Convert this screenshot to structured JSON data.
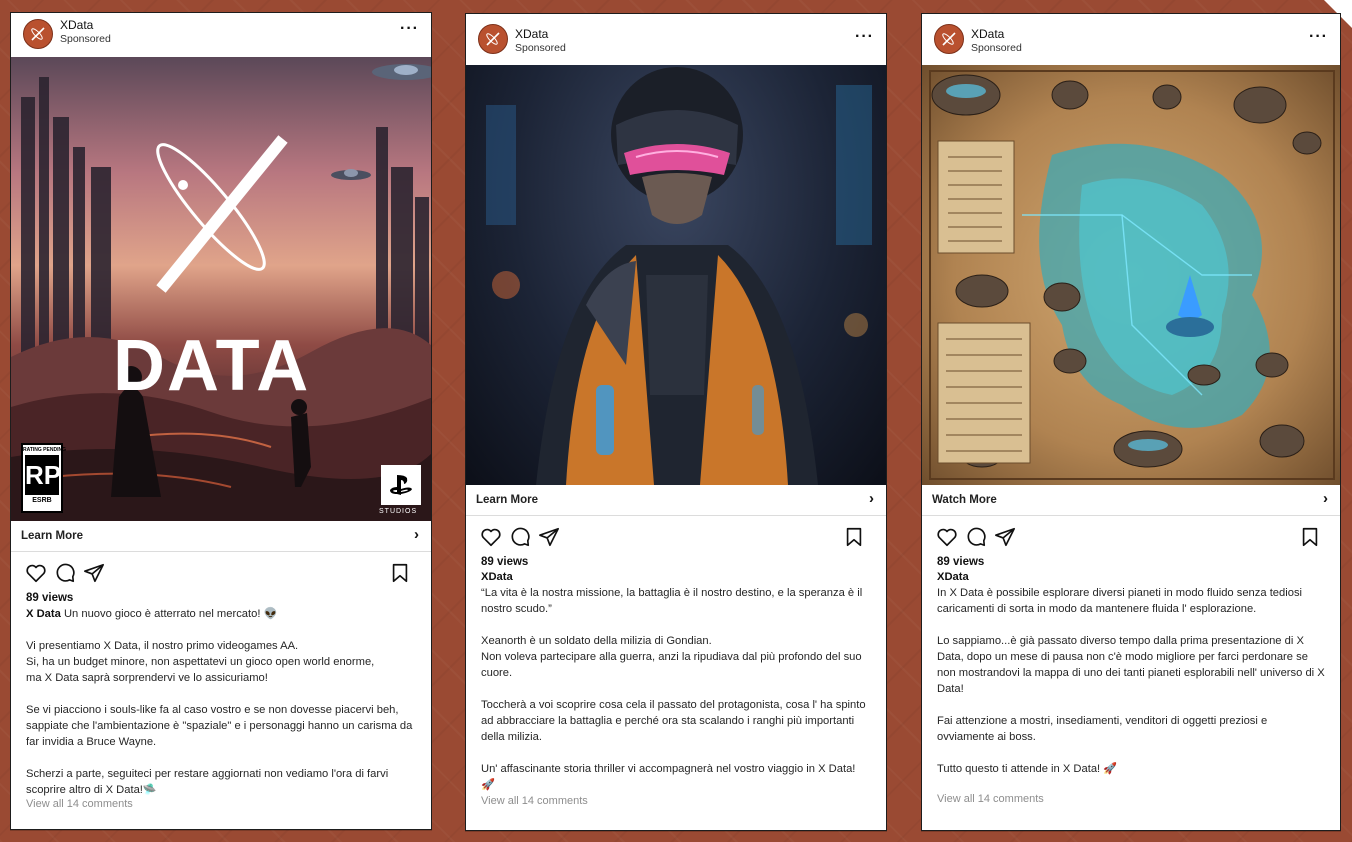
{
  "posts": [
    {
      "account": "XData",
      "sponsored": "Sponsored",
      "cta": "Learn More",
      "views": "89 views",
      "username": "X Data",
      "caption": [
        "Un nuovo gioco è atterrato nel mercato! 👽",
        "Vi presentiamo X Data, il nostro primo videogames AA.",
        "Si, ha un budget minore, non aspettatevi un gioco open world enorme,",
        "ma X Data saprà sorprendervi ve lo assicuriamo!",
        "Se vi piacciono i souls-like fa al caso vostro e se non dovesse piacervi beh, sappiate che l'ambientazione è \"spaziale\" e i personaggi hanno un carisma da far invidia a Bruce Wayne.",
        "Scherzi a parte, seguiteci per restare aggiornati non vediamo l'ora di farvi scoprire altro di X Data!🛸"
      ],
      "comments": "View all 14 comments",
      "media": {
        "logo_text": "DATA",
        "rating_top": "RATING PENDING",
        "rating_mid": "RP",
        "rating_bottom": "ESRB",
        "studio": "STUDIOS"
      }
    },
    {
      "account": "XData",
      "sponsored": "Sponsored",
      "cta": "Learn More",
      "views": "89 views",
      "username": "XData",
      "caption": [
        "“La vita è la nostra missione, la battaglia è il nostro destino, e la speranza è il nostro scudo.”",
        "Xeanorth è un soldato della milizia di Gondian.",
        "Non voleva partecipare alla guerra, anzi la ripudiava dal più profondo del suo cuore.",
        "Toccherà a voi scoprire cosa cela il passato del protagonista, cosa l' ha spinto ad abbracciare la battaglia e perché ora sta scalando i ranghi più importanti della milizia.",
        "Un' affascinante storia thriller vi accompagnerà nel vostro viaggio in X Data! 🚀"
      ],
      "comments": "View all 14 comments"
    },
    {
      "account": "XData",
      "sponsored": "Sponsored",
      "cta": "Watch More",
      "views": "89 views",
      "username": "XData",
      "caption": [
        "In X Data è possibile esplorare diversi pianeti in modo fluido senza tediosi caricamenti di sorta in modo da mantenere fluida l' esplorazione.",
        "Lo sappiamo...è già passato diverso tempo dalla prima presentazione di X Data, dopo un mese di pausa non c'è modo migliore per farci perdonare se non mostrandovi la mappa di uno dei tanti pianeti esplorabili nell' universo di X Data!",
        "Fai attenzione a mostri, insediamenti, venditori di oggetti preziosi e ovviamente ai boss.",
        "Tutto questo ti attende in X Data! 🚀"
      ],
      "comments": "View all 14 comments"
    }
  ],
  "colors": {
    "background": "#9a4a33",
    "avatar": "#b9512f"
  },
  "icons": [
    "heart-icon",
    "comment-icon",
    "share-icon",
    "bookmark-icon",
    "more-icon",
    "chevron-right-icon"
  ]
}
